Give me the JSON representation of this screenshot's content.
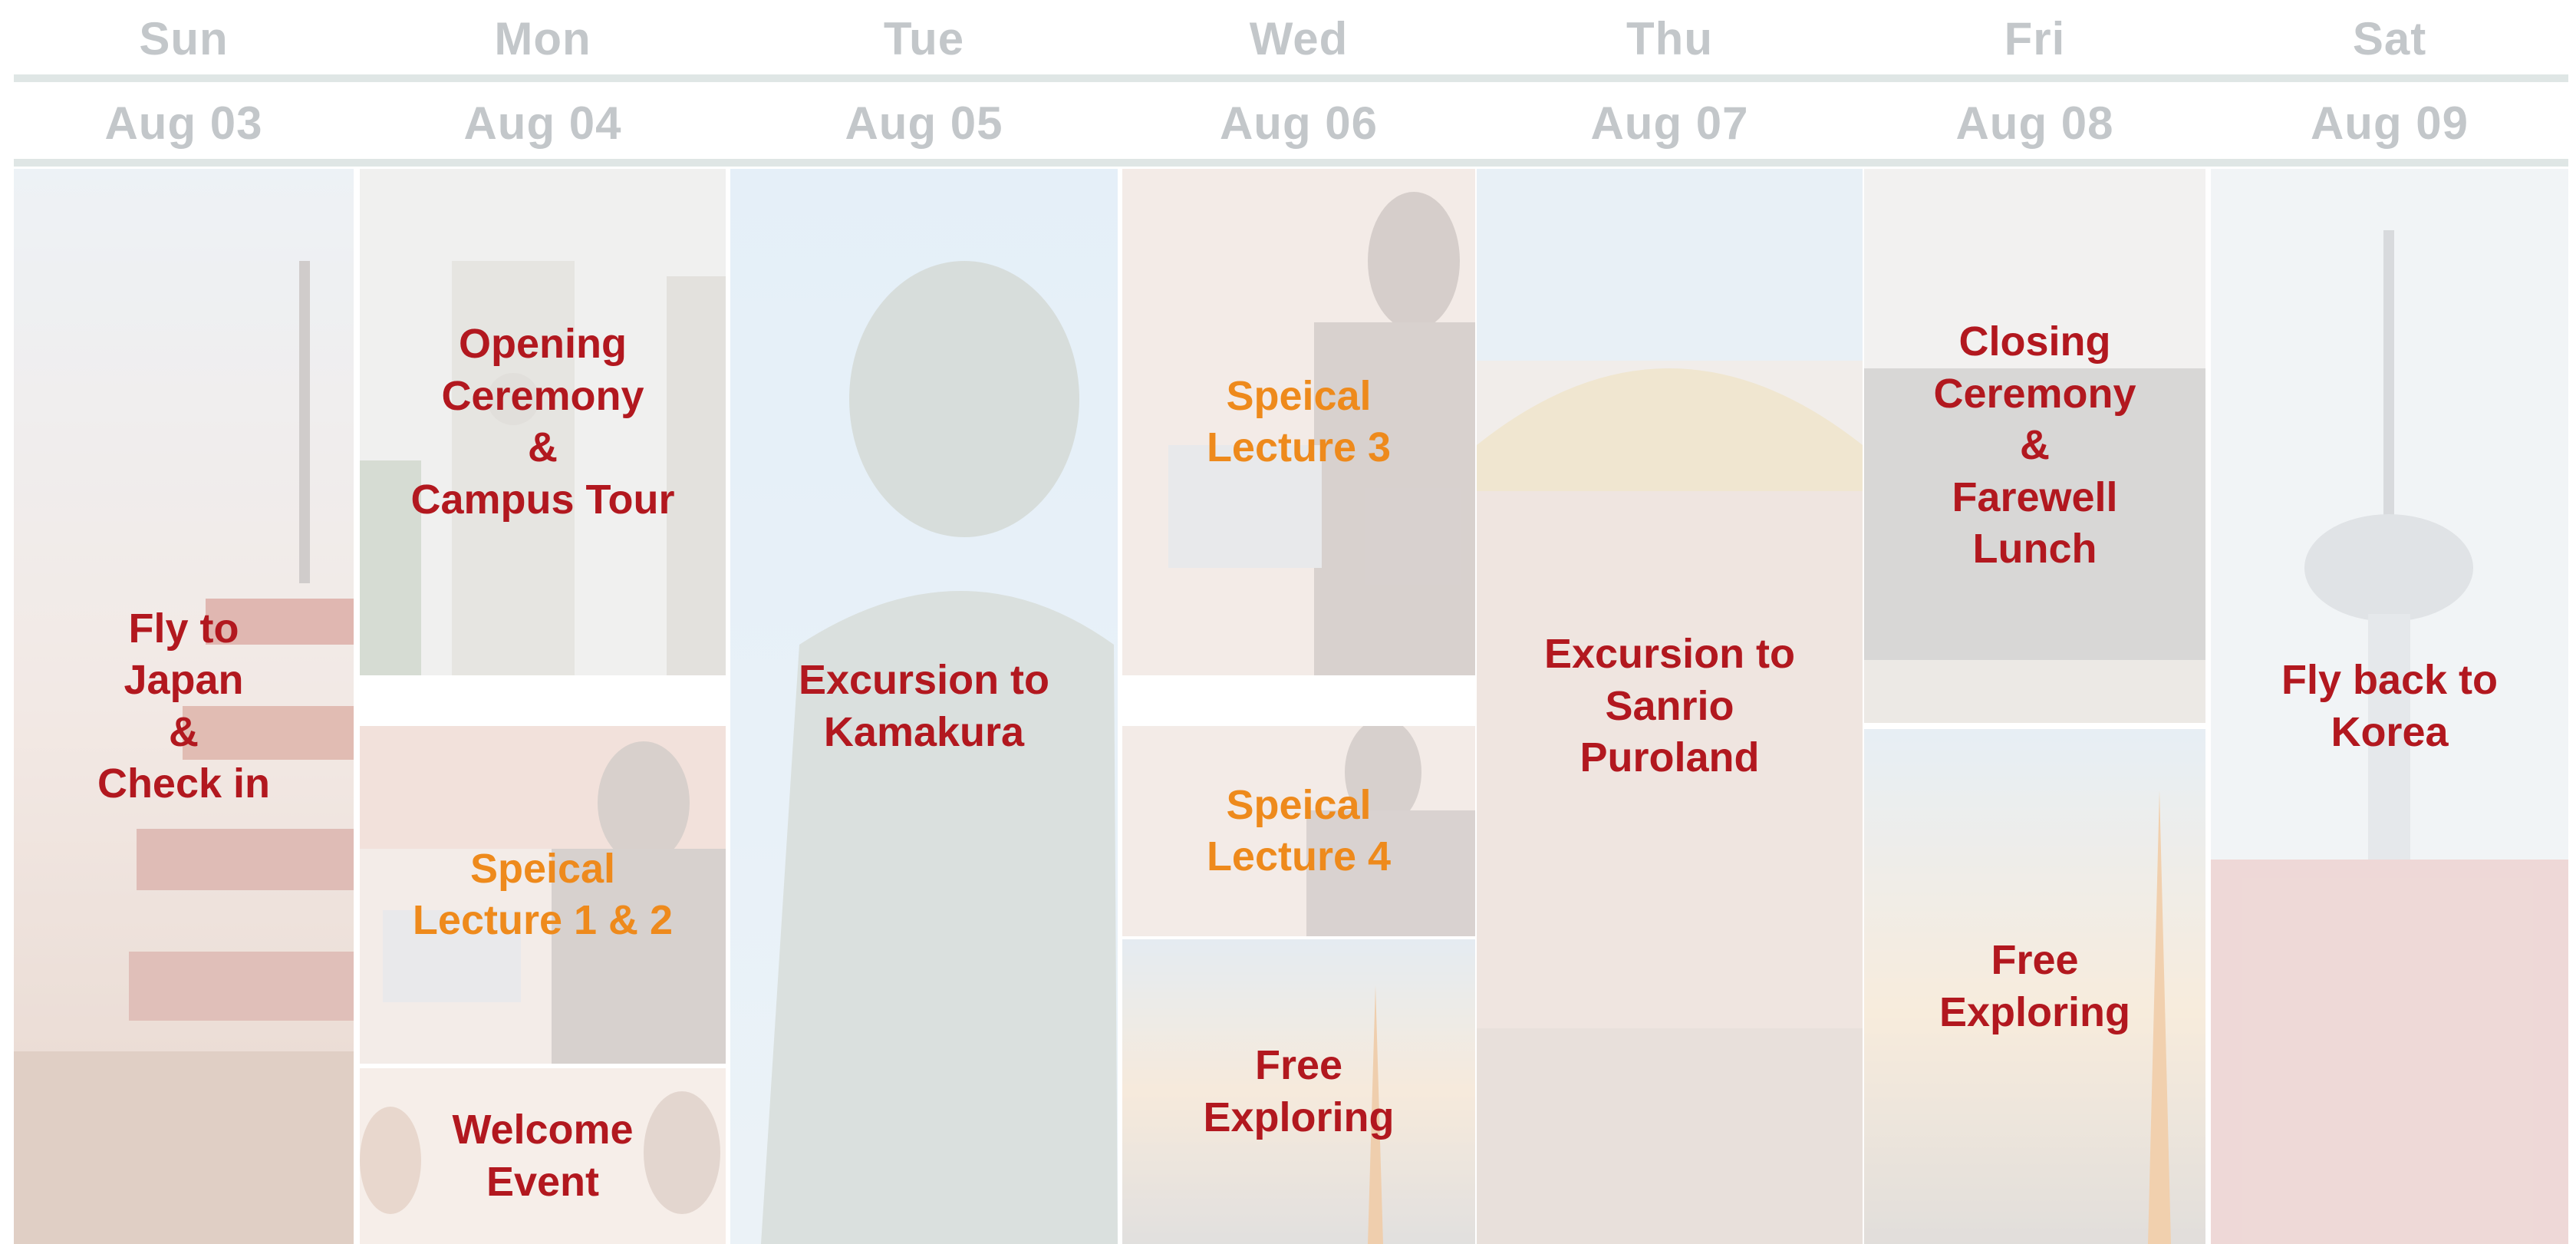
{
  "days": [
    {
      "weekday": "Sun",
      "date": "Aug 03"
    },
    {
      "weekday": "Mon",
      "date": "Aug 04"
    },
    {
      "weekday": "Tue",
      "date": "Aug 05"
    },
    {
      "weekday": "Wed",
      "date": "Aug 06"
    },
    {
      "weekday": "Thu",
      "date": "Aug 07"
    },
    {
      "weekday": "Fri",
      "date": "Aug 08"
    },
    {
      "weekday": "Sat",
      "date": "Aug 09"
    }
  ],
  "events": {
    "sun": {
      "label": "Fly to\nJapan\n&\nCheck in"
    },
    "mon_opening": {
      "label": "Opening\nCeremony\n&\nCampus Tour"
    },
    "mon_lecture": {
      "label": "Speical\nLecture 1 & 2"
    },
    "mon_welcome": {
      "label": "Welcome\nEvent"
    },
    "tue": {
      "label": "Excursion to\nKamakura"
    },
    "wed_lecture3": {
      "label": "Speical\nLecture 3"
    },
    "wed_lecture4": {
      "label": "Speical\nLecture 4"
    },
    "wed_free": {
      "label": "Free\nExploring"
    },
    "thu": {
      "label": "Excursion to\nSanrio\nPuroland"
    },
    "fri_closing": {
      "label": "Closing\nCeremony\n&\nFarewell\nLunch"
    },
    "fri_free": {
      "label": "Free\nExploring"
    },
    "sat": {
      "label": "Fly back to\nKorea"
    }
  },
  "colors": {
    "event_red": "#b2181f",
    "event_orange": "#ee8a1c",
    "header_gray": "#c3c7ca"
  }
}
